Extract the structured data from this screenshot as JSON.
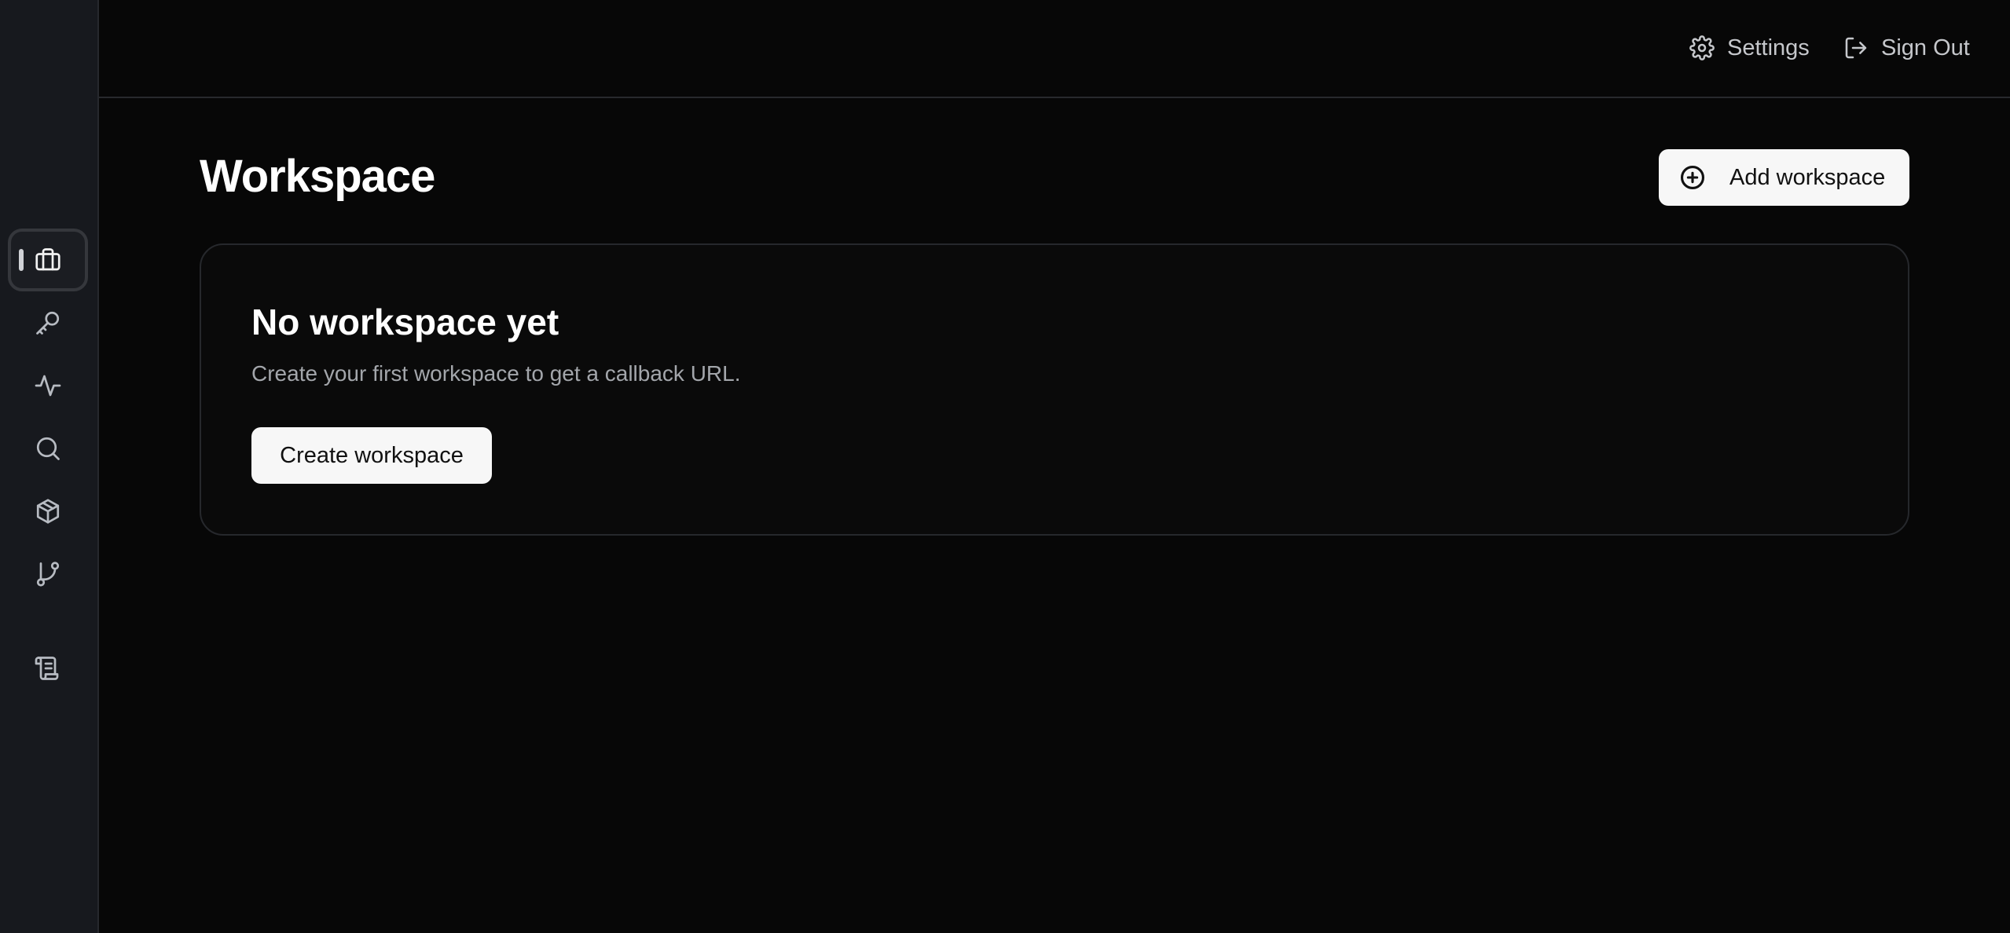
{
  "header": {
    "settings_label": "Settings",
    "settings_icon": "gear-icon",
    "signout_label": "Sign Out",
    "signout_icon": "log-out-icon"
  },
  "sidebar": {
    "items": [
      {
        "icon": "briefcase-icon",
        "active": true
      },
      {
        "icon": "key-icon",
        "active": false
      },
      {
        "icon": "activity-icon",
        "active": false
      },
      {
        "icon": "search-icon",
        "active": false
      },
      {
        "icon": "package-icon",
        "active": false
      },
      {
        "icon": "git-branch-icon",
        "active": false
      },
      {
        "icon": "scroll-icon",
        "active": false
      }
    ]
  },
  "main": {
    "title": "Workspace",
    "add_button_label": "Add workspace",
    "add_button_icon": "plus-circle-icon",
    "empty_state": {
      "title": "No workspace yet",
      "description": "Create your first workspace to get a callback URL.",
      "button_label": "Create workspace"
    }
  },
  "colors": {
    "background": "#070707",
    "sidebar": "#17191e",
    "button_bg": "#f7f7f7",
    "muted_text": "#a3a6ab"
  }
}
